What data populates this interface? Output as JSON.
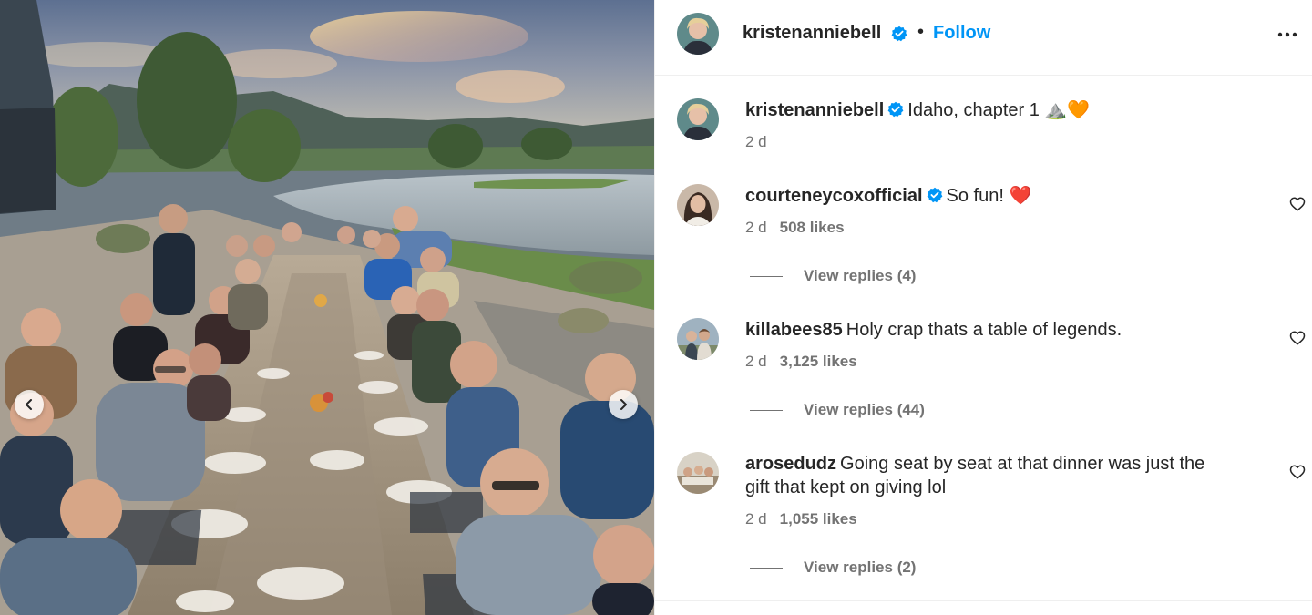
{
  "post": {
    "author": "kristenanniebell",
    "verified": true,
    "follow_label": "Follow",
    "separator": "•",
    "more_icon": "more-horizontal-icon"
  },
  "caption": {
    "username": "kristenanniebell",
    "text": "Idaho, chapter 1 ⛰️🧡",
    "time": "2 d"
  },
  "comments": [
    {
      "username": "courteneycoxofficial",
      "verified": true,
      "text": "So fun! ❤️",
      "time": "2 d",
      "likes": "508 likes",
      "replies": "View replies (4)"
    },
    {
      "username": "killabees85",
      "verified": false,
      "text": "Holy crap thats a table of legends.",
      "time": "2 d",
      "likes": "3,125 likes",
      "replies": "View replies (44)"
    },
    {
      "username": "arosedudz",
      "verified": false,
      "text": "Going seat by seat at that dinner was just the",
      "text_line2": "gift that kept on giving lol",
      "time": "2 d",
      "likes": "1,055 likes",
      "replies": "View replies (2)"
    }
  ],
  "colors": {
    "link_blue": "#0095f6",
    "verified_blue": "#0095f6",
    "muted": "#737373",
    "text": "#262626"
  },
  "icons": {
    "prev": "chevron-left-icon",
    "next": "chevron-right-icon",
    "like": "heart-outline-icon",
    "verified": "verified-badge-icon"
  }
}
